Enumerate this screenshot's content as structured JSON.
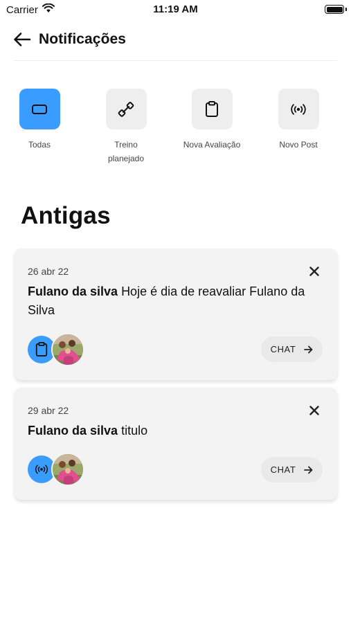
{
  "status_bar": {
    "carrier": "Carrier",
    "time": "11:19 AM"
  },
  "header": {
    "title": "Notificações"
  },
  "filters": [
    {
      "label": "Todas",
      "icon": "rectangle-icon",
      "active": true
    },
    {
      "label": "Treino planejado",
      "icon": "dumbbell-icon",
      "active": false
    },
    {
      "label": "Nova Avaliação",
      "icon": "clipboard-icon",
      "active": false
    },
    {
      "label": "Novo Post",
      "icon": "broadcast-icon",
      "active": false
    }
  ],
  "section": {
    "title": "Antigas"
  },
  "notifications": [
    {
      "date": "26 abr 22",
      "author": "Fulano da silva",
      "message": "Hoje é dia de reavaliar Fulano da Silva",
      "type_icon": "clipboard-icon",
      "chat_label": "CHAT"
    },
    {
      "date": "29 abr 22",
      "author": "Fulano da silva",
      "message": "titulo",
      "type_icon": "broadcast-icon",
      "chat_label": "CHAT"
    }
  ],
  "colors": {
    "accent": "#3b9cff",
    "chip_bg": "#eeeeee",
    "card_bg": "#f3f3f3"
  }
}
